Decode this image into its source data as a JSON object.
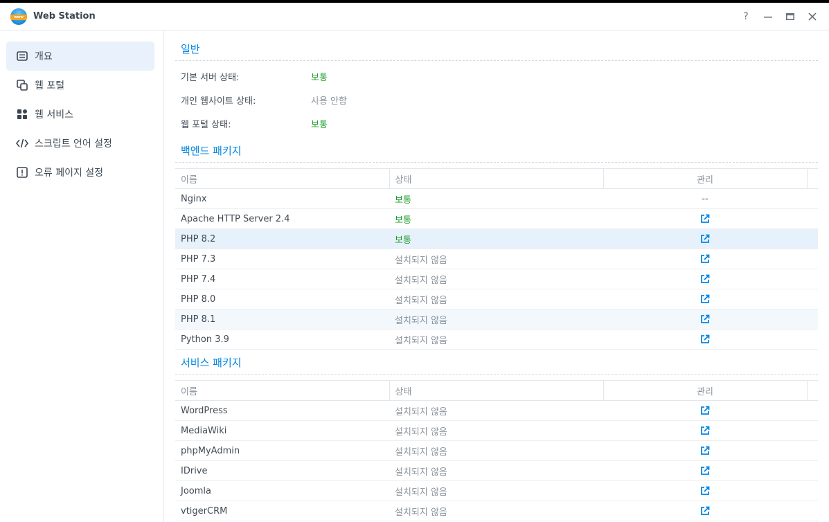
{
  "window": {
    "title": "Web Station",
    "app_icon_text": "www",
    "controls": {
      "help": "?",
      "minimize": "—",
      "maximize": "□",
      "close": "✕"
    }
  },
  "sidebar": {
    "items": [
      {
        "label": "개요",
        "icon": "overview-icon",
        "active": true
      },
      {
        "label": "웹 포털",
        "icon": "web-portal-icon",
        "active": false
      },
      {
        "label": "웹 서비스",
        "icon": "web-service-icon",
        "active": false
      },
      {
        "label": "스크립트 언어 설정",
        "icon": "code-icon",
        "active": false
      },
      {
        "label": "오류 페이지 설정",
        "icon": "error-page-icon",
        "active": false
      }
    ]
  },
  "general": {
    "title": "일반",
    "rows": [
      {
        "label": "기본 서버 상태:",
        "value": "보통",
        "status": "ok"
      },
      {
        "label": "개인 웹사이트 상태:",
        "value": "사용 안함",
        "status": "muted"
      },
      {
        "label": "웹 포털 상태:",
        "value": "보통",
        "status": "ok"
      }
    ]
  },
  "backend": {
    "title": "백엔드 패키지",
    "columns": {
      "name": "이름",
      "status": "상태",
      "manage": "관리"
    },
    "rows": [
      {
        "name": "Nginx",
        "status": "보통",
        "ok": true,
        "manage": "--"
      },
      {
        "name": "Apache HTTP Server 2.4",
        "status": "보통",
        "ok": true,
        "manage": "link"
      },
      {
        "name": "PHP 8.2",
        "status": "보통",
        "ok": true,
        "manage": "link"
      },
      {
        "name": "PHP 7.3",
        "status": "설치되지 않음",
        "ok": false,
        "manage": "link"
      },
      {
        "name": "PHP 7.4",
        "status": "설치되지 않음",
        "ok": false,
        "manage": "link"
      },
      {
        "name": "PHP 8.0",
        "status": "설치되지 않음",
        "ok": false,
        "manage": "link"
      },
      {
        "name": "PHP 8.1",
        "status": "설치되지 않음",
        "ok": false,
        "manage": "link"
      },
      {
        "name": "Python 3.9",
        "status": "설치되지 않음",
        "ok": false,
        "manage": "link"
      }
    ]
  },
  "services": {
    "title": "서비스 패키지",
    "columns": {
      "name": "이름",
      "status": "상태",
      "manage": "관리"
    },
    "rows": [
      {
        "name": "WordPress",
        "status": "설치되지 않음",
        "ok": false,
        "manage": "link"
      },
      {
        "name": "MediaWiki",
        "status": "설치되지 않음",
        "ok": false,
        "manage": "link"
      },
      {
        "name": "phpMyAdmin",
        "status": "설치되지 않음",
        "ok": false,
        "manage": "link"
      },
      {
        "name": "IDrive",
        "status": "설치되지 않음",
        "ok": false,
        "manage": "link"
      },
      {
        "name": "Joomla",
        "status": "설치되지 않음",
        "ok": false,
        "manage": "link"
      },
      {
        "name": "vtigerCRM",
        "status": "설치되지 않음",
        "ok": false,
        "manage": "link"
      }
    ]
  },
  "colors": {
    "accent": "#0086e5",
    "ok": "#1f9f2e",
    "muted": "#8a939c",
    "selected_row": "#e6f1fc"
  }
}
